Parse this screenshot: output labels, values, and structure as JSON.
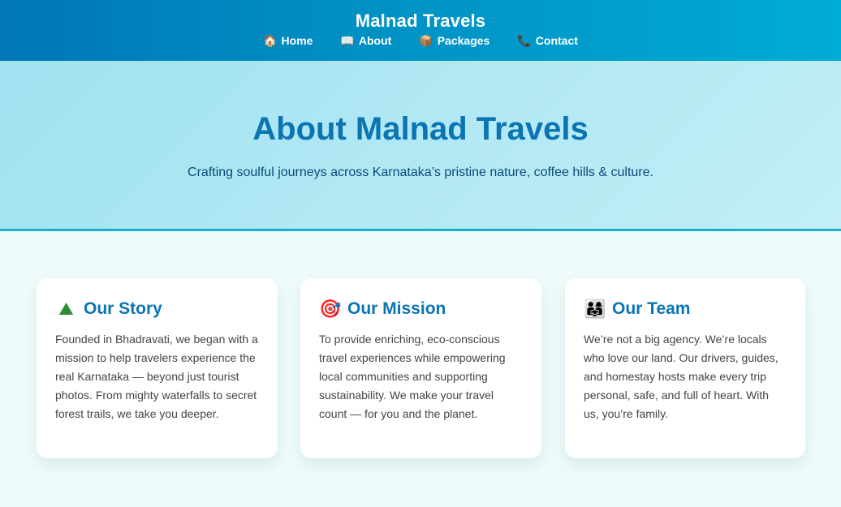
{
  "header": {
    "brand": "Malnad Travels",
    "nav": [
      {
        "icon": "home-icon",
        "glyph": "🏠",
        "label": "Home"
      },
      {
        "icon": "book-icon",
        "glyph": "📖",
        "label": "About"
      },
      {
        "icon": "package-icon",
        "glyph": "📦",
        "label": "Packages"
      },
      {
        "icon": "phone-icon",
        "glyph": "📞",
        "label": "Contact"
      }
    ]
  },
  "hero": {
    "title": "About Malnad Travels",
    "subtitle": "Crafting soulful journeys across Karnataka’s pristine nature, coffee hills & culture."
  },
  "cards": [
    {
      "icon": "mountain-icon",
      "glyph": "⛰",
      "title": "Our Story",
      "text": "Founded in Bhadravati, we began with a mission to help travelers experience the real Karnataka — beyond just tourist photos. From mighty waterfalls to secret forest trails, we take you deeper."
    },
    {
      "icon": "target-icon",
      "glyph": "🎯",
      "title": "Our Mission",
      "text": "To provide enriching, eco-conscious travel experiences while empowering local communities and supporting sustainability. We make your travel count — for you and the planet."
    },
    {
      "icon": "family-icon",
      "glyph": "👨‍👩‍👧",
      "title": "Our Team",
      "text": "We’re not a big agency. We’re locals who love our land. Our drivers, guides, and homestay hosts make every trip personal, safe, and full of heart. With us, you’re family."
    }
  ],
  "colors": {
    "header_start": "#0077b6",
    "header_end": "#00abd6",
    "accent_title": "#0b74b3",
    "hero_bg": "#b3e9f4",
    "page_bg": "#f0fcfb"
  }
}
